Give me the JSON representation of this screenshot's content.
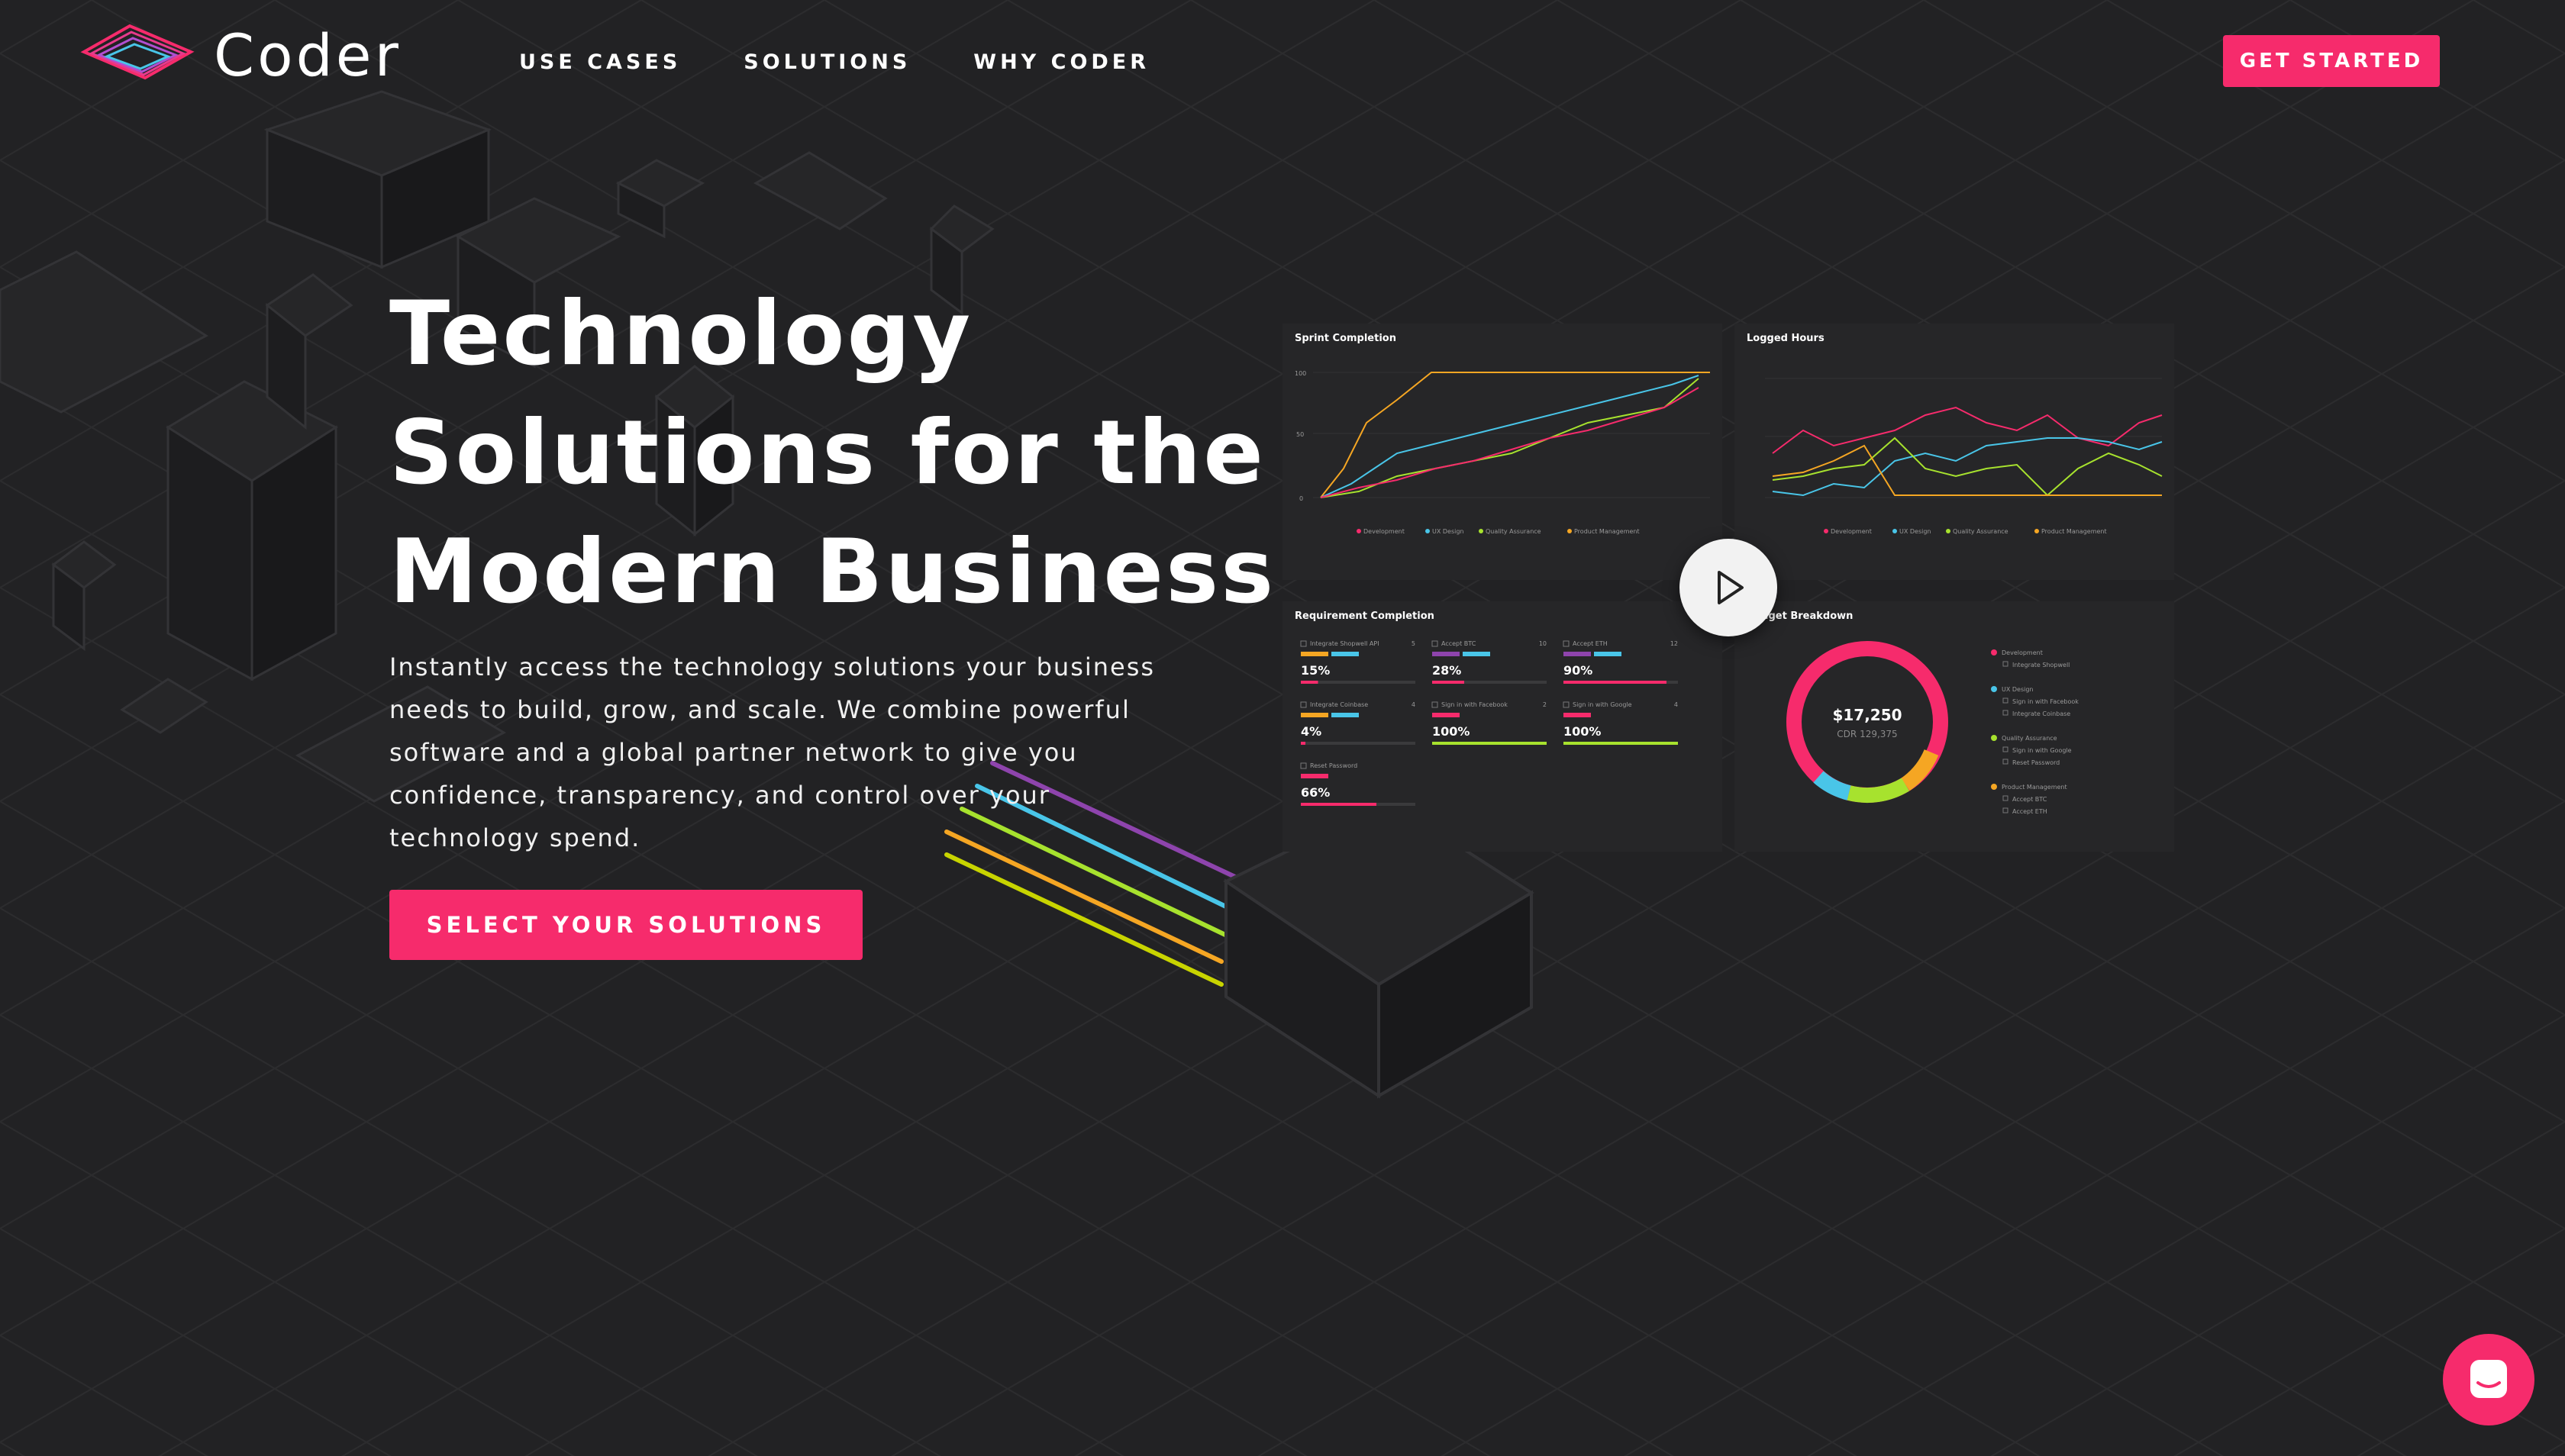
{
  "brand": {
    "name": "Coder"
  },
  "nav": {
    "links": [
      "USE CASES",
      "SOLUTIONS",
      "WHY CODER"
    ],
    "cta": "GET STARTED"
  },
  "hero": {
    "title_lines": [
      "Technology",
      "Solutions for the",
      "Modern Business"
    ],
    "description_lines": [
      "Instantly access the technology solutions your business",
      "needs to build, grow, and scale. We combine powerful",
      "software and a global partner network to give you",
      "confidence, transparency, and control over your",
      "technology spend."
    ],
    "cta": "SELECT YOUR SOLUTIONS"
  },
  "dashboard": {
    "sprint_title": "Sprint Completion",
    "logged_title": "Logged Hours",
    "requirement_title": "Requirement Completion",
    "budget_title": "Budget Breakdown",
    "legend": [
      "Development",
      "UX Design",
      "Quality Assurance",
      "Product Management"
    ],
    "requirements": [
      {
        "label": "Integrate Shopwell API",
        "count": "5",
        "percent": "15%",
        "fill": 0.15
      },
      {
        "label": "Accept BTC",
        "count": "10",
        "percent": "28%",
        "fill": 0.28
      },
      {
        "label": "Accept ETH",
        "count": "12",
        "percent": "90%",
        "fill": 0.9
      },
      {
        "label": "Integrate Coinbase",
        "count": "4",
        "percent": "4%",
        "fill": 0.04
      },
      {
        "label": "Sign in with Facebook",
        "count": "2",
        "percent": "100%",
        "fill": 1.0
      },
      {
        "label": "Sign in with Google",
        "count": "4",
        "percent": "100%",
        "fill": 1.0
      },
      {
        "label": "Reset Password",
        "count": "",
        "percent": "66%",
        "fill": 0.66
      }
    ],
    "budget": {
      "amount": "$17,250",
      "sub": "CDR 129,375",
      "groups": [
        {
          "name": "Development",
          "color": "#f62b6c",
          "items": [
            "Integrate Shopwell"
          ]
        },
        {
          "name": "UX Design",
          "color": "#49c5e8",
          "items": [
            "Sign in with Facebook",
            "Integrate Coinbase"
          ]
        },
        {
          "name": "Quality Assurance",
          "color": "#a7e22e",
          "items": [
            "Sign in with Google",
            "Reset Password"
          ]
        },
        {
          "name": "Product Management",
          "color": "#f5a623",
          "items": [
            "Accept BTC",
            "Accept ETH"
          ]
        }
      ]
    },
    "colors": {
      "pink": "#f62b6c",
      "blue": "#49c5e8",
      "green": "#a7e22e",
      "orange": "#f5a623"
    }
  },
  "icons": {
    "play": "play-icon",
    "chat": "chat-icon",
    "logo": "logo-icon"
  }
}
